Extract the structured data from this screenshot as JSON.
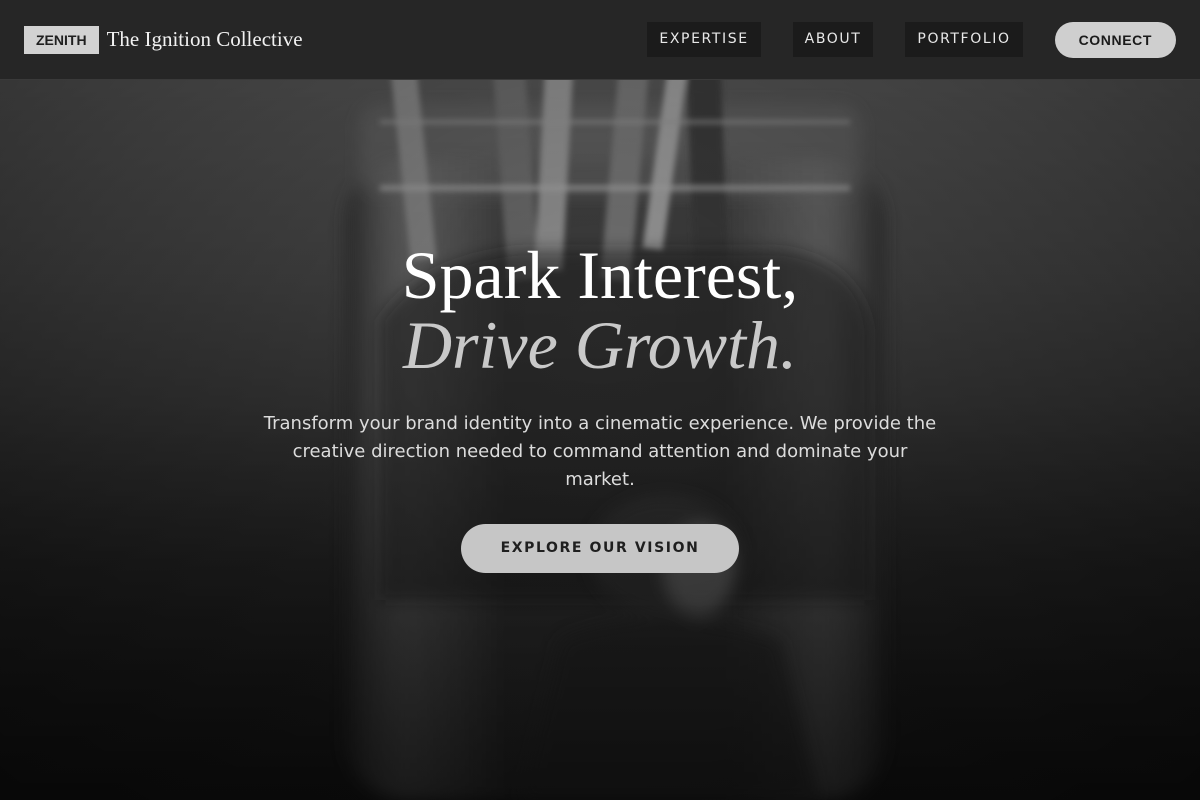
{
  "brand": {
    "badge": "ZENITH",
    "name": "The Ignition Collective"
  },
  "nav": {
    "items": [
      {
        "label": "EXPERTISE"
      },
      {
        "label": "ABOUT"
      },
      {
        "label": "PORTFOLIO"
      }
    ],
    "cta_label": "CONNECT"
  },
  "hero": {
    "headline_line1": "Spark Interest,",
    "headline_line2": "Drive Growth.",
    "tagline": "Transform your brand identity into a cinematic experience. We provide the creative direction needed to command attention and dominate your market.",
    "cta_label": "EXPLORE OUR VISION",
    "background_image": "jar-with-brushes-photo"
  },
  "colors": {
    "header_bg": "#262626",
    "nav_item_bg": "#1b1b1b",
    "button_bg": "#cfcfcf",
    "headline_accent": "#c9c9c9"
  }
}
